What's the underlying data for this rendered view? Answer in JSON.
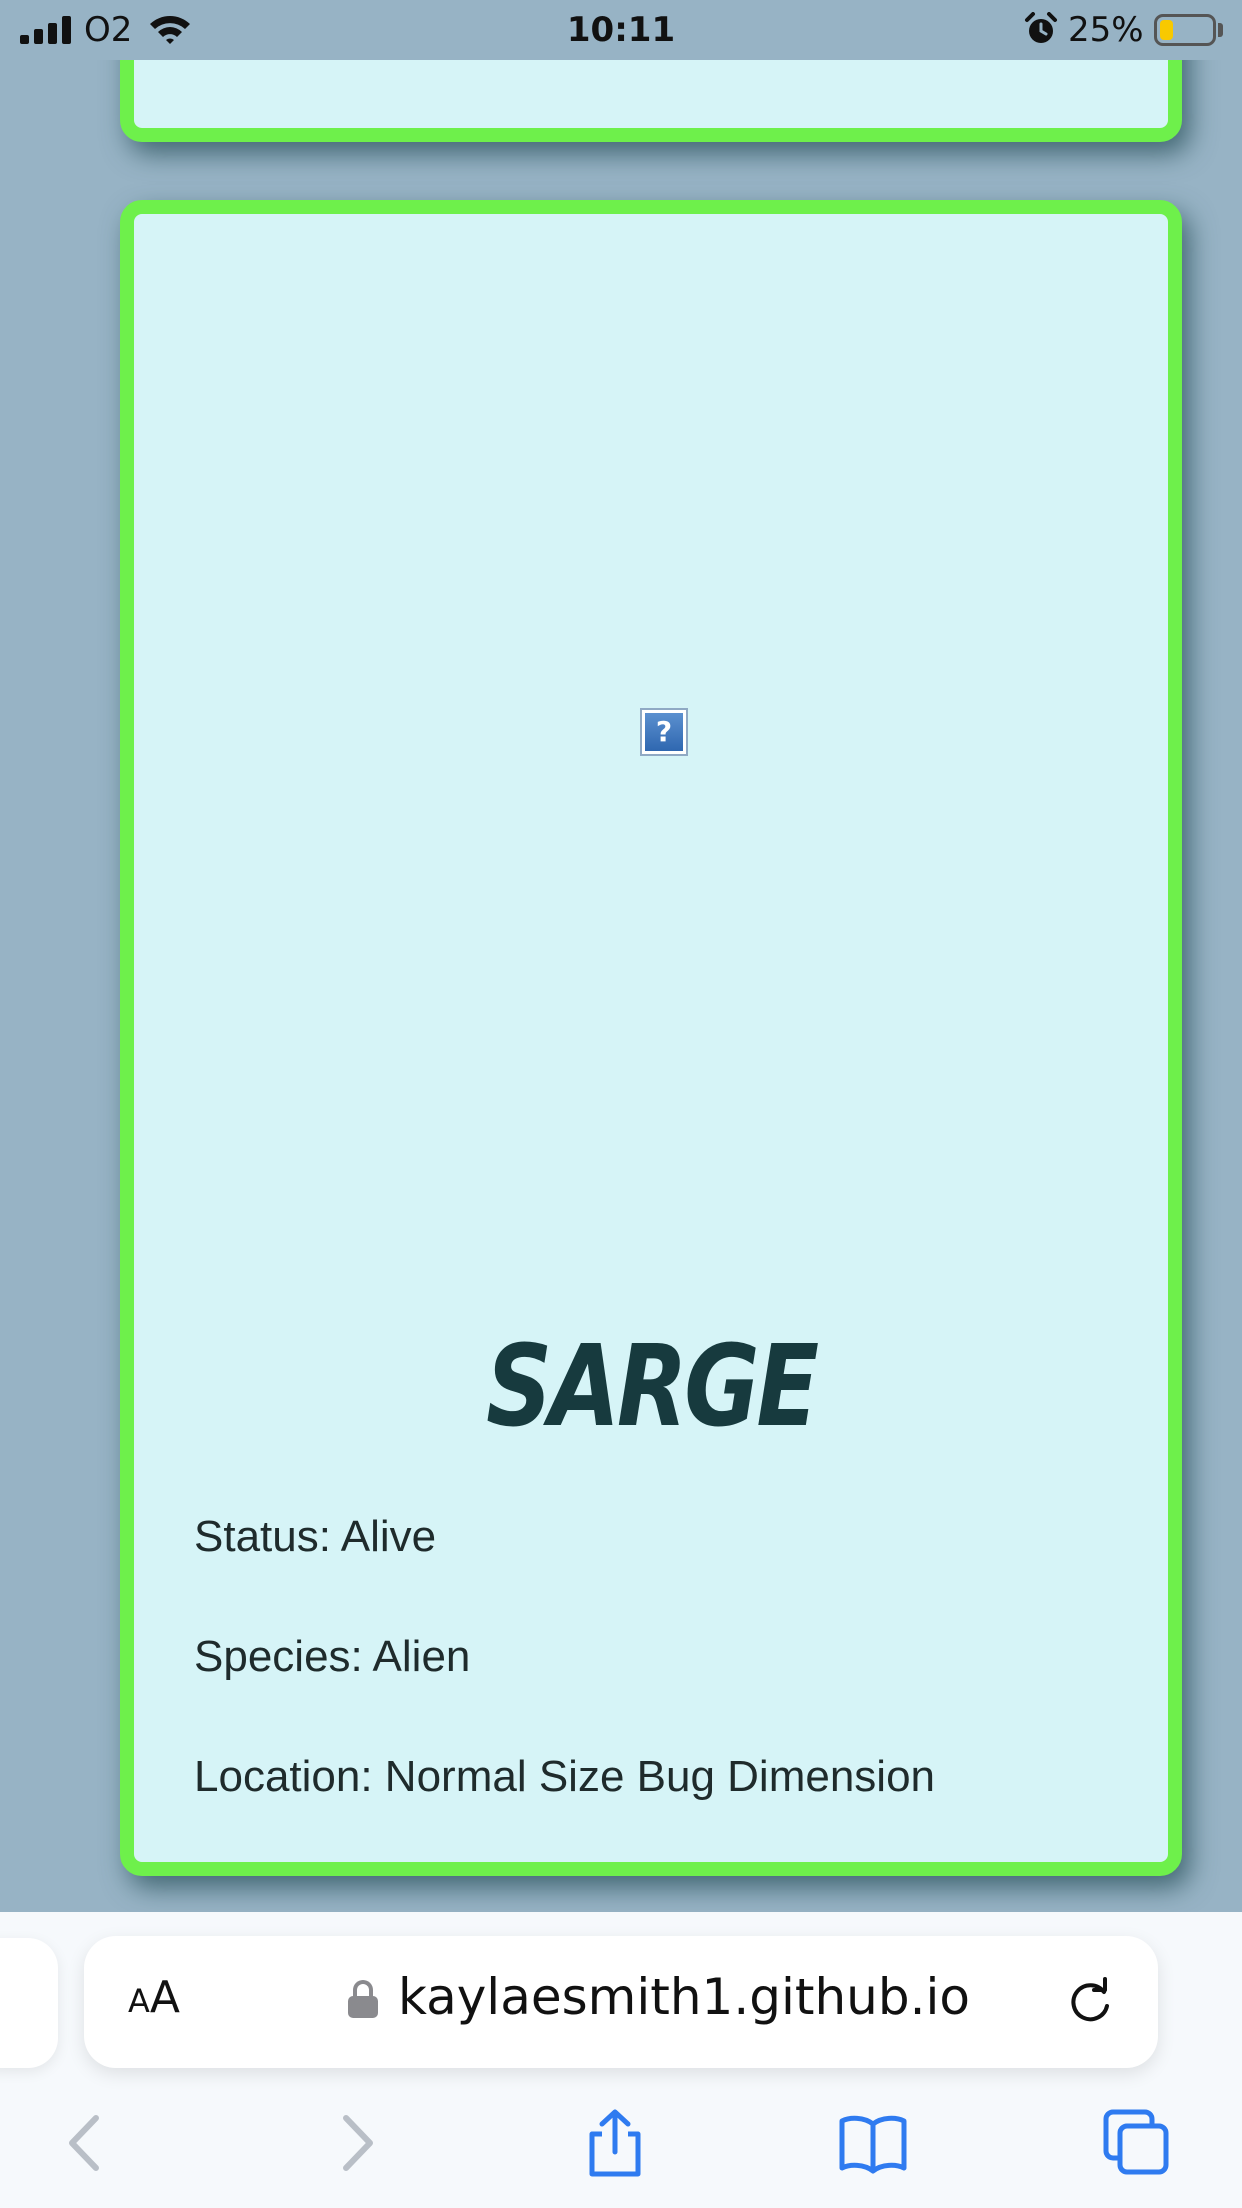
{
  "status_bar": {
    "carrier": "O2",
    "time": "10:11",
    "battery_percent": "25%",
    "battery_level": 0.25,
    "icons": [
      "signal-icon",
      "wifi-icon",
      "alarm-icon",
      "battery-icon"
    ]
  },
  "character_card": {
    "image_alt": "?",
    "name": "Sarge",
    "status": "Status: Alive",
    "species": "Species: Alien",
    "location": "Location: Normal Size Bug Dimension"
  },
  "browser": {
    "text_size_label_small": "A",
    "text_size_label_large": "A",
    "url": "kaylaesmith1.github.io",
    "toolbar_icons": [
      "back-icon",
      "forward-icon",
      "share-icon",
      "bookmarks-icon",
      "tabs-icon"
    ]
  },
  "colors": {
    "page_background": "#97b3c5",
    "card_background": "#d6f4f7",
    "card_border": "#6ef04b",
    "name_color": "#173a3e",
    "browser_accent": "#2f7bf0"
  }
}
